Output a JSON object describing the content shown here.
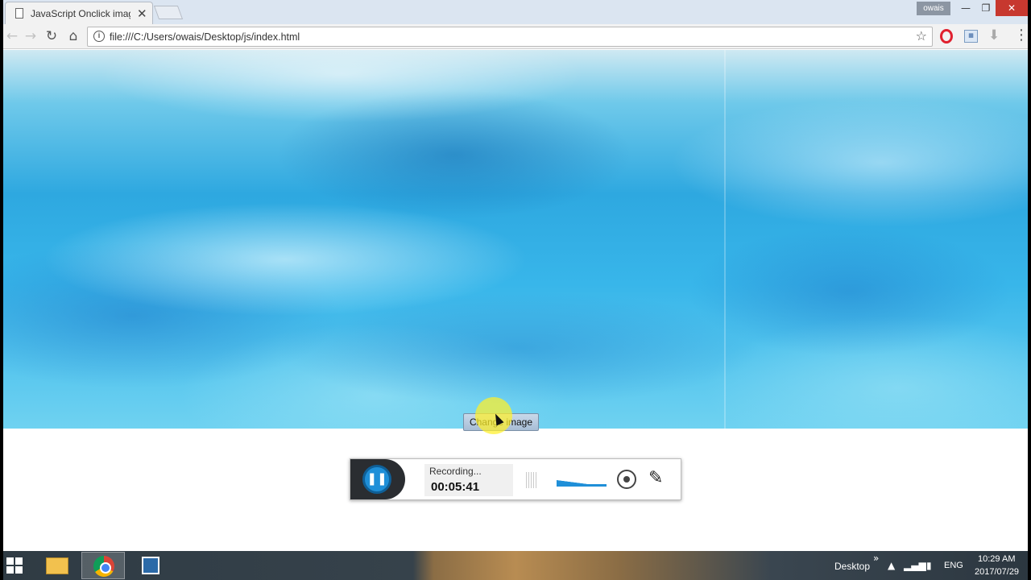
{
  "browser": {
    "tab_title": "JavaScript Onclick image",
    "tab_close": "✕",
    "user_badge": "owais",
    "url": "file:///C:/Users/owais/Desktop/js/index.html",
    "icons": [
      "back-arrow-icon",
      "forward-arrow-icon",
      "reload-icon",
      "home-icon",
      "info-icon",
      "star-icon",
      "opera-icon",
      "extension-icon",
      "download-icon",
      "menu-icon"
    ]
  },
  "page": {
    "button_label": "Change image"
  },
  "recorder": {
    "status": "Recording...",
    "timer": "00:05:41"
  },
  "taskbar": {
    "desktop_label": "Desktop",
    "language": "ENG",
    "time": "10:29 AM",
    "date": "2017/07/29"
  },
  "colors": {
    "accent_blue": "#1f8fd8",
    "water": "#2ea8e0",
    "close_red": "#c7382f"
  }
}
